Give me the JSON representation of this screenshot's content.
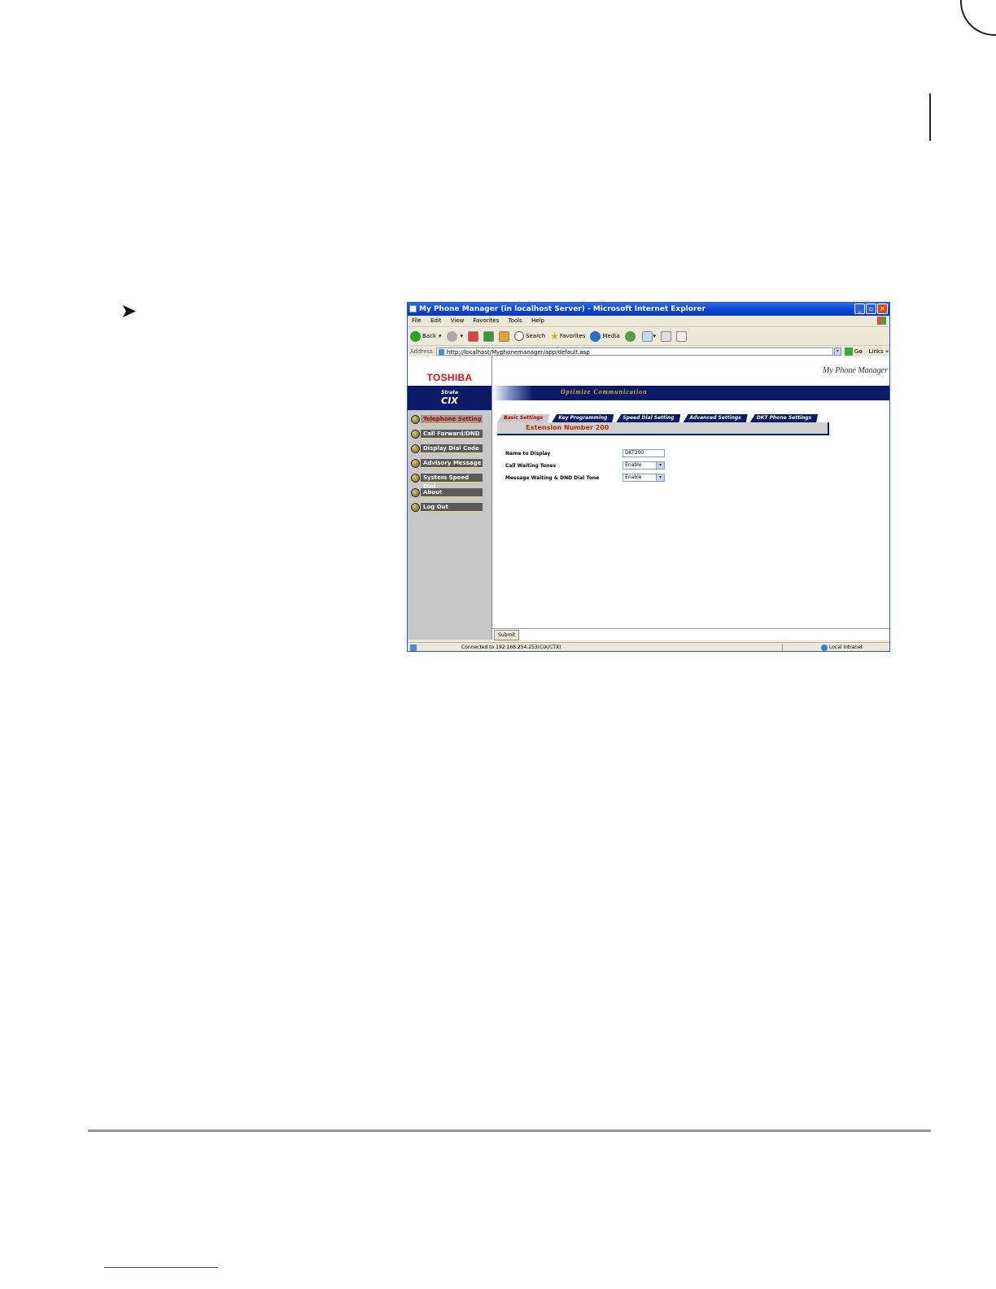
{
  "window": {
    "title": "My Phone Manager (in localhost Server) - Microsoft Internet Explorer"
  },
  "menu": [
    "File",
    "Edit",
    "View",
    "Favorites",
    "Tools",
    "Help"
  ],
  "toolbar": {
    "back": "Back",
    "search": "Search",
    "favorites": "Favorites",
    "media": "Media"
  },
  "address": {
    "label": "Address",
    "url": "http://localhost/Myphonemanager/app/default.asp",
    "go": "Go",
    "links": "Links"
  },
  "sidebar": {
    "logo": "TOSHIBA",
    "strata_small": "Strata",
    "strata_large": "CIX",
    "items": [
      {
        "label": "Telephone Setting"
      },
      {
        "label": "Call Forward/DND"
      },
      {
        "label": "Display Dial Code"
      },
      {
        "label": "Advisory Message"
      },
      {
        "label": "System Speed Dial"
      },
      {
        "label": "About"
      },
      {
        "label": "Log Out"
      }
    ]
  },
  "header": {
    "brand": "My Phone Manager",
    "slogan": "Optimize Communication"
  },
  "tabs": [
    {
      "label": "Basic Settings"
    },
    {
      "label": "Key Programming"
    },
    {
      "label": "Speed Dial Setting"
    },
    {
      "label": "Advanced Settings"
    },
    {
      "label": "DKT Phone Settings"
    }
  ],
  "extension": "Extension Number 200",
  "form": {
    "name_label": "Name to Display",
    "name_value": "DKT200",
    "call_waiting_label": "Call Waiting Tones",
    "call_waiting_value": "Enable",
    "mw_label": "Message Waiting & DND Dial Tone",
    "mw_value": "Enable"
  },
  "submit": "Submit",
  "status": {
    "text": "Connected to 192.168.254.253(CIX/CTX)",
    "zone": "Local intranet"
  }
}
